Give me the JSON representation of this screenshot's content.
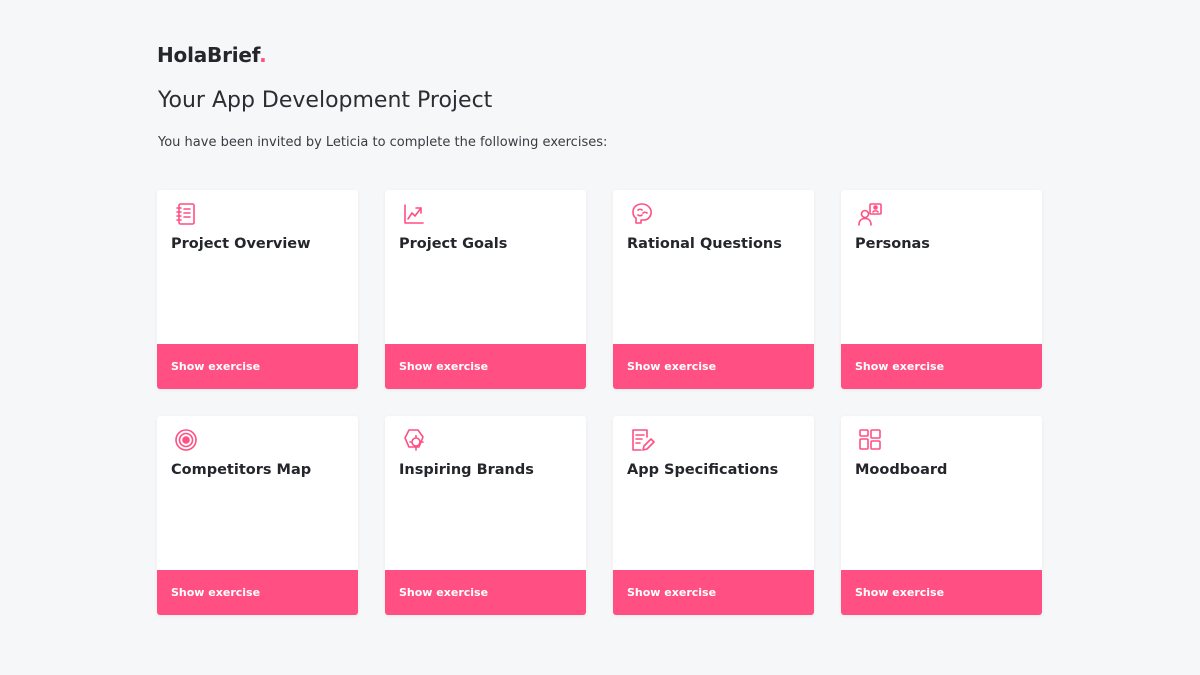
{
  "brand": {
    "name": "HolaBrief",
    "dot": ".",
    "accent": "#ff4f83"
  },
  "header": {
    "title": "Your App Development Project",
    "subtitle": "You have been invited by Leticia to complete the following exercises:"
  },
  "cards": [
    {
      "title": "Project Overview",
      "icon": "notebook-icon",
      "action": "Show exercise"
    },
    {
      "title": "Project Goals",
      "icon": "growth-chart-icon",
      "action": "Show exercise"
    },
    {
      "title": "Rational Questions",
      "icon": "brain-icon",
      "action": "Show exercise"
    },
    {
      "title": "Personas",
      "icon": "persona-icon",
      "action": "Show exercise"
    },
    {
      "title": "Competitors Map",
      "icon": "target-icon",
      "action": "Show exercise"
    },
    {
      "title": "Inspiring Brands",
      "icon": "lightbulb-icon",
      "action": "Show exercise"
    },
    {
      "title": "App Specifications",
      "icon": "document-edit-icon",
      "action": "Show exercise"
    },
    {
      "title": "Moodboard",
      "icon": "grid-layout-icon",
      "action": "Show exercise"
    }
  ]
}
